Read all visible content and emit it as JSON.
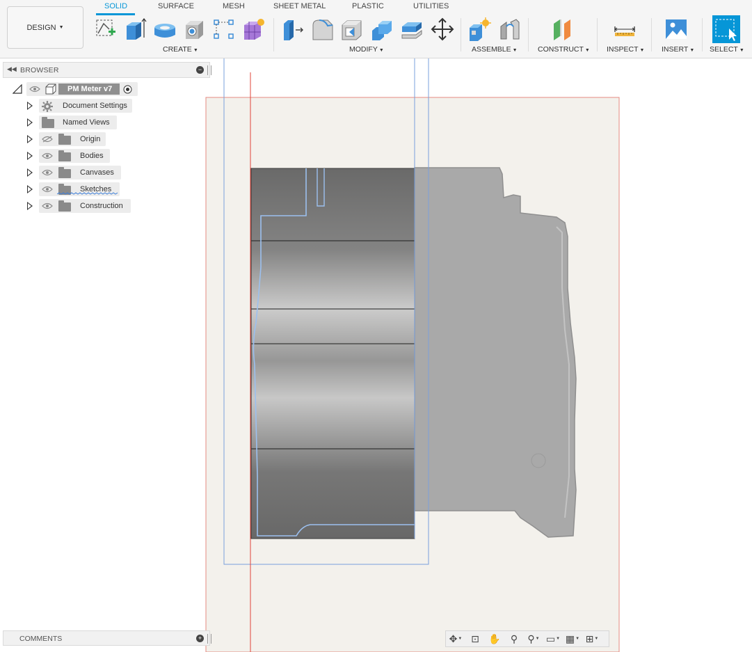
{
  "workspace": {
    "label": "DESIGN"
  },
  "tabs": [
    {
      "label": "SOLID",
      "active": true
    },
    {
      "label": "SURFACE",
      "active": false
    },
    {
      "label": "MESH",
      "active": false
    },
    {
      "label": "SHEET METAL",
      "active": false
    },
    {
      "label": "PLASTIC",
      "active": false
    },
    {
      "label": "UTILITIES",
      "active": false
    }
  ],
  "groups": {
    "create": "CREATE",
    "modify": "MODIFY",
    "assemble": "ASSEMBLE",
    "construct": "CONSTRUCT",
    "inspect": "INSPECT",
    "insert": "INSERT",
    "select": "SELECT"
  },
  "icons": {
    "create": [
      "new-sketch-icon",
      "extrude-icon",
      "revolve-icon",
      "hole-icon",
      "pattern-icon",
      "create-form-icon"
    ],
    "modify": [
      "press-pull-icon",
      "fillet-icon",
      "shell-icon",
      "combine-icon",
      "offset-face-icon",
      "move-copy-icon"
    ],
    "assemble": [
      "new-component-icon",
      "joint-icon"
    ],
    "construct": [
      "offset-plane-icon"
    ],
    "inspect": [
      "measure-icon"
    ],
    "insert": [
      "insert-image-icon"
    ],
    "select": [
      "select-icon"
    ]
  },
  "browser": {
    "title": "BROWSER",
    "root": {
      "label": "PM Meter v7"
    },
    "nodes": [
      {
        "label": "Document Settings",
        "icon": "gear-icon"
      },
      {
        "label": "Named Views",
        "icon": "folder-icon"
      },
      {
        "label": "Origin",
        "icon": "folder-icon",
        "visible": false
      },
      {
        "label": "Bodies",
        "icon": "folder-icon",
        "visible": true
      },
      {
        "label": "Canvases",
        "icon": "folder-icon",
        "visible": true
      },
      {
        "label": "Sketches",
        "icon": "folder-icon",
        "visible": true
      },
      {
        "label": "Construction",
        "icon": "folder-icon",
        "visible": true
      }
    ]
  },
  "comments": {
    "title": "COMMENTS"
  },
  "navbar": [
    "orbit-icon",
    "look-at-icon",
    "pan-icon",
    "zoom-icon",
    "fit-icon",
    "display-settings-icon",
    "grid-icon",
    "viewports-icon"
  ],
  "colors": {
    "accent": "#0696d7",
    "sketch_line": "#6f95d8",
    "axis_red": "#e0443a",
    "body_gray": "#6f6f6f",
    "canvas_bg": "#f3f1ec"
  }
}
